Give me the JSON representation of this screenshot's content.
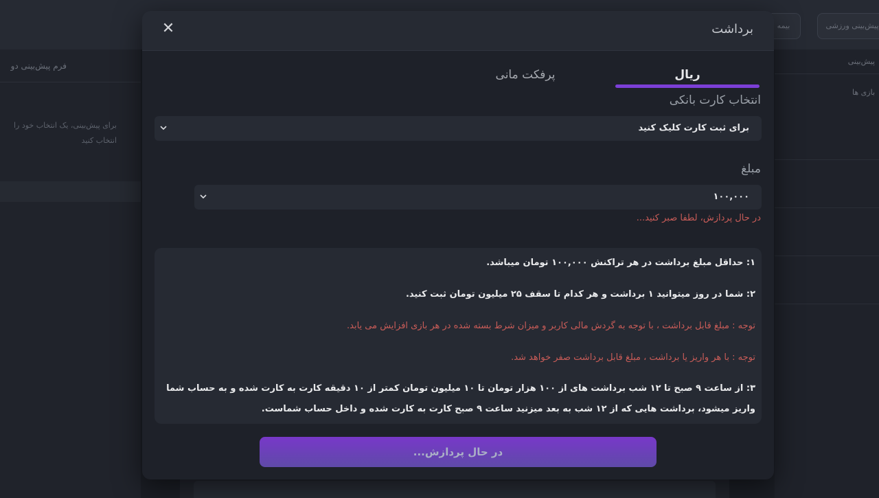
{
  "background": {
    "top_pills": [
      "بیمه",
      "پیش‌بینی ورزشی"
    ],
    "left_panel_title": "فرم پیش‌بینی دو",
    "left_panel_text": "برای پیش‌بینی، یک انتخاب خود را انتخاب کنید",
    "right_panel_title": "پیش‌بینی",
    "right_panel_text": "بازی ها"
  },
  "modal": {
    "title": "برداشت",
    "tabs": [
      {
        "label": "ریال",
        "active": true
      },
      {
        "label": "پرفکت مانی",
        "active": false
      }
    ],
    "bank_card": {
      "label": "انتخاب کارت بانکی",
      "value": "برای ثبت کارت کلیک کنید"
    },
    "amount": {
      "label": "مبلغ",
      "value": "۱۰۰,۰۰۰"
    },
    "processing_message": "در حال پردازش، لطفا صبر کنید...",
    "info": {
      "line1": "۱: حداقل مبلغ برداشت در هر تراکنش ۱۰۰,۰۰۰ تومان میباشد.",
      "line2": "۲: شما در روز میتوانید ۱ برداشت و هر کدام تا سقف ۲۵ میلیون تومان ثبت کنید.",
      "note1": "توجه : مبلغ قابل برداشت ، با توجه به گردش مالی کاربر و میزان شرط بسته شده در هر بازی افزایش می یابد.",
      "note2": "توجه : با هر واریز یا برداشت ، مبلغ قابل برداشت صفر خواهد شد.",
      "line3": "۳: از ساعت ۹ صبح تا ۱۲ شب برداشت های از ۱۰۰ هزار تومان تا ۱۰ میلیون تومان کمتر از ۱۰ دقیقه کارت به کارت شده و به حساب شما واریز میشود، برداشت هایی که از ۱۲ شب به بعد میزنید ساعت ۹ صبح کارت به کارت شده و داخل حساب شماست."
    },
    "submit_label": "در حال پردازش..."
  },
  "colors": {
    "accent": "#7c3fd6",
    "warning_text": "#c95c58",
    "modal_bg": "#1e2129"
  }
}
